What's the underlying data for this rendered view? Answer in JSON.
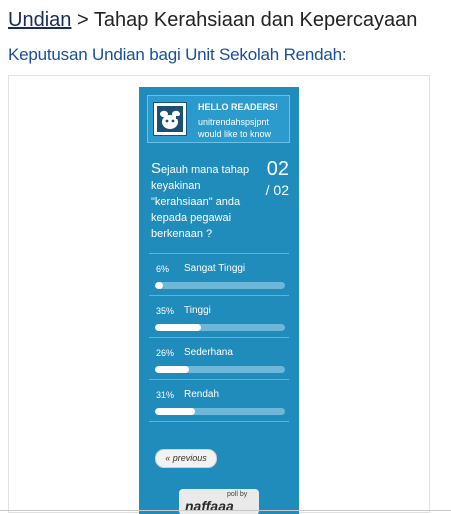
{
  "header": {
    "breadcrumb_link": "Undian",
    "breadcrumb_sep": ">",
    "breadcrumb_title": "Tahap Kerahsiaan dan Kepercayaan"
  },
  "subtitle": "Keputusan Undian bagi Unit Sekolah Rendah:",
  "widget": {
    "hello_title": "HELLO READERS!",
    "hello_line1": "unitrendahspsjpnt",
    "hello_line2": "would like to know",
    "question_first": "S",
    "question_rest": "ejauh mana tahap keyakinan \"kerahsiaan\" anda kepada pegawai berkenaan ?",
    "page_current": "02",
    "page_total": "/ 02",
    "options": [
      {
        "pct": "6%",
        "label": "Sangat Tinggi",
        "value": 0.06
      },
      {
        "pct": "35%",
        "label": "Tinggi",
        "value": 0.35
      },
      {
        "pct": "26%",
        "label": "Sederhana",
        "value": 0.26
      },
      {
        "pct": "31%",
        "label": "Rendah",
        "value": 0.31
      }
    ],
    "prev_label": "« previous",
    "brand_by": "poll by",
    "brand_name": "naffaaa"
  },
  "colors": {
    "widget_bg": "#1f8cbc",
    "bar_track": "#6db7d9",
    "bar_fill": "#ffffff",
    "subtitle": "#1a4f9a"
  }
}
